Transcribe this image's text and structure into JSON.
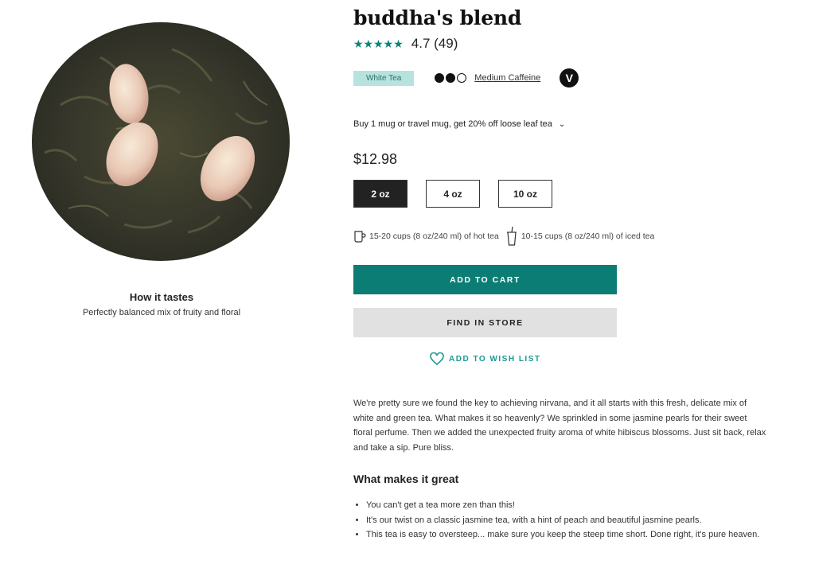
{
  "product": {
    "title": "buddha's blend",
    "rating": "4.7 (49)",
    "stars": "★★★★★",
    "tea_type": "White Tea",
    "caffeine_label": "Medium Caffeine",
    "vegan_badge": "V",
    "promo": "Buy 1 mug or travel mug, get 20% off loose leaf tea",
    "price": "$12.98",
    "sizes": [
      "2 oz",
      "4 oz",
      "10 oz"
    ],
    "selected_size": "2 oz",
    "serving_hot": "15-20 cups (8 oz/240 ml) of hot tea",
    "serving_iced": "10-15 cups (8 oz/240 ml) of iced tea"
  },
  "taste": {
    "title": "How it tastes",
    "description": "Perfectly balanced mix of fruity and floral"
  },
  "actions": {
    "add_to_cart": "ADD TO CART",
    "find_in_store": "FIND IN STORE",
    "add_to_wishlist": "ADD TO WISH LIST"
  },
  "description": "We're pretty sure we found the key to achieving nirvana, and it all starts with this fresh, delicate mix of white and green tea. What makes it so heavenly? We sprinkled in some jasmine pearls for their sweet floral perfume. Then we added the unexpected fruity aroma of white hibiscus blossoms. Just sit back, relax and take a sip. Pure bliss.",
  "great": {
    "title": "What makes it great",
    "items": [
      "You can't get a tea more zen than this!",
      "It's our twist on a classic jasmine tea, with a hint of peach and beautiful jasmine pearls.",
      "This tea is easy to oversteep... make sure you keep the steep time short. Done right, it's pure heaven."
    ]
  },
  "colors": {
    "accent": "#0b7d74",
    "tea_type_bg": "#b6e3de",
    "secondary_button": "#e1e1e1"
  },
  "icons": [
    "star-icon",
    "caffeine-dot-icon",
    "vegan-icon",
    "chevron-down-icon",
    "hot-mug-icon",
    "iced-cup-icon",
    "heart-icon"
  ]
}
